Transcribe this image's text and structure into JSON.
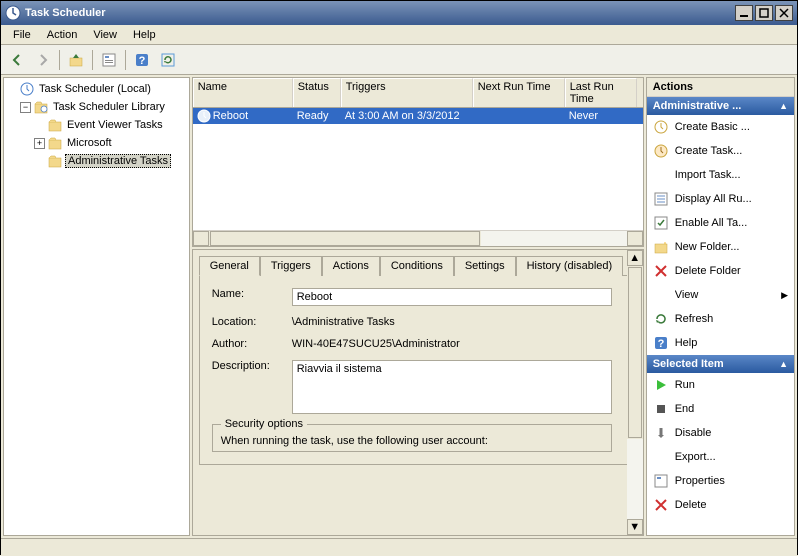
{
  "window": {
    "title": "Task Scheduler"
  },
  "menu": {
    "file": "File",
    "action": "Action",
    "view": "View",
    "help": "Help"
  },
  "tree": {
    "root": "Task Scheduler (Local)",
    "library": "Task Scheduler Library",
    "eventviewer": "Event Viewer Tasks",
    "microsoft": "Microsoft",
    "admin": "Administrative Tasks"
  },
  "task_list": {
    "columns": {
      "name": "Name",
      "status": "Status",
      "triggers": "Triggers",
      "next": "Next Run Time",
      "last": "Last Run Time"
    },
    "rows": [
      {
        "name": "Reboot",
        "status": "Ready",
        "triggers": "At 3:00 AM on 3/3/2012",
        "next": "",
        "last": "Never"
      }
    ]
  },
  "details": {
    "tabs": {
      "general": "General",
      "triggers": "Triggers",
      "actions": "Actions",
      "conditions": "Conditions",
      "settings": "Settings",
      "history": "History (disabled)"
    },
    "labels": {
      "name": "Name:",
      "location": "Location:",
      "author": "Author:",
      "description": "Description:"
    },
    "values": {
      "name": "Reboot",
      "location": "\\Administrative Tasks",
      "author": "WIN-40E47SUCU25\\Administrator",
      "description": "Riavvia il sistema"
    },
    "security": {
      "legend": "Security options",
      "line1": "When running the task, use the following user account:"
    }
  },
  "actions": {
    "title": "Actions",
    "section1": "Administrative ...",
    "items1": {
      "create_basic": "Create Basic ...",
      "create_task": "Create Task...",
      "import_task": "Import Task...",
      "display_all": "Display All Ru...",
      "enable_all": "Enable All Ta...",
      "new_folder": "New Folder...",
      "delete_folder": "Delete Folder",
      "view": "View",
      "refresh": "Refresh",
      "help": "Help"
    },
    "section2": "Selected Item",
    "items2": {
      "run": "Run",
      "end": "End",
      "disable": "Disable",
      "export": "Export...",
      "properties": "Properties",
      "delete": "Delete"
    }
  }
}
